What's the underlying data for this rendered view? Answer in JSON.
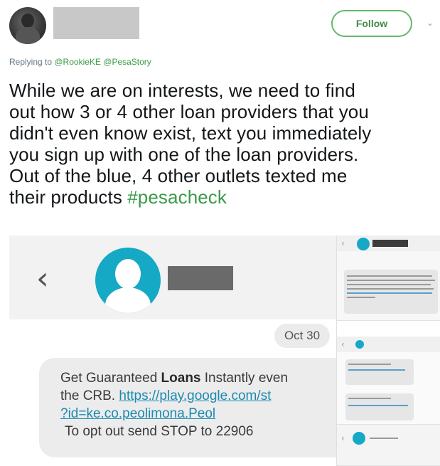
{
  "tweet": {
    "follow_label": "Follow",
    "caret": "⌄",
    "replying_prefix": "Replying to ",
    "reply_handles": [
      "@RookieKE",
      "@PesaStory"
    ],
    "text_lines": [
      "While we are on interests, we need to find",
      "out how 3 or 4 other loan providers that you",
      "didn't even know exist, text you immediately",
      "you sign up with one of the loan providers.",
      "Out of the blue, 4 other outlets texted me",
      "their products "
    ],
    "hashtag": "#pesacheck"
  },
  "media": {
    "back_glyph": "‹",
    "date_label": "Oct 30",
    "message": {
      "line1_pre": "Get Guaranteed ",
      "line1_bold": "Loans",
      "line1_post": " Instantly even",
      "line2_pre": "the CRB. ",
      "line2_link": "https://play.google.com/st",
      "line3_link": "?id=ke.co.peolimona.Peol",
      "line4": "To opt out send STOP to 22906"
    }
  },
  "colors": {
    "accent_green": "#3a9a48",
    "avatar_teal": "#15a9c6",
    "link_blue": "#1a8ab0"
  }
}
